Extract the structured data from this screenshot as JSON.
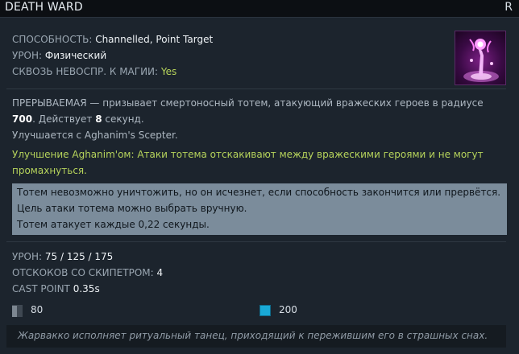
{
  "header": {
    "title": "DEATH WARD",
    "hotkey": "R"
  },
  "attributes": [
    {
      "label": "СПОСОБНОСТЬ:",
      "value": "Channelled, Point Target"
    },
    {
      "label": "УРОН:",
      "value": "Физический"
    },
    {
      "label": "СКВОЗЬ НЕВОСПР. К МАГИИ:",
      "value": "Yes"
    }
  ],
  "ability_icon": "death-ward-totem-icon",
  "description": {
    "part1": "ПРЕРЫВАЕМАЯ — призывает смертоносный тотем, атакующий вражеских героев в радиусе ",
    "radius": "700",
    "part2": ". Действует ",
    "duration": "8",
    "part3": " секунд.",
    "upgrade_line": "Улучшается с Aghanim's Scepter."
  },
  "scepter_upgrade": "Улучшение Aghanim'ом: Атаки тотема отскакивают между вражескими героями и не могут промахнуться.",
  "notes": [
    "Тотем невозможно уничтожить, но он исчезнет, если способность закончится или прервётся.",
    "Цель атаки тотема можно выбрать вручную.",
    "Тотем атакует каждые 0,22 секунды."
  ],
  "stats": [
    {
      "label": "УРОН:",
      "value": "75 / 125 / 175"
    },
    {
      "label": "ОТСКОКОВ СО СКИПЕТРОМ:",
      "value": "4"
    },
    {
      "label": "CAST POINT",
      "value": "0.35s"
    }
  ],
  "costs": {
    "cooldown": "80",
    "mana": "200"
  },
  "colors": {
    "accent_green": "#b6d35b",
    "mana_blue": "#19a9d6",
    "notes_bg": "#7b8c9b"
  },
  "lore": "Жарвакко исполняет ритуальный танец, приходящий к пережившим его в страшных снах."
}
